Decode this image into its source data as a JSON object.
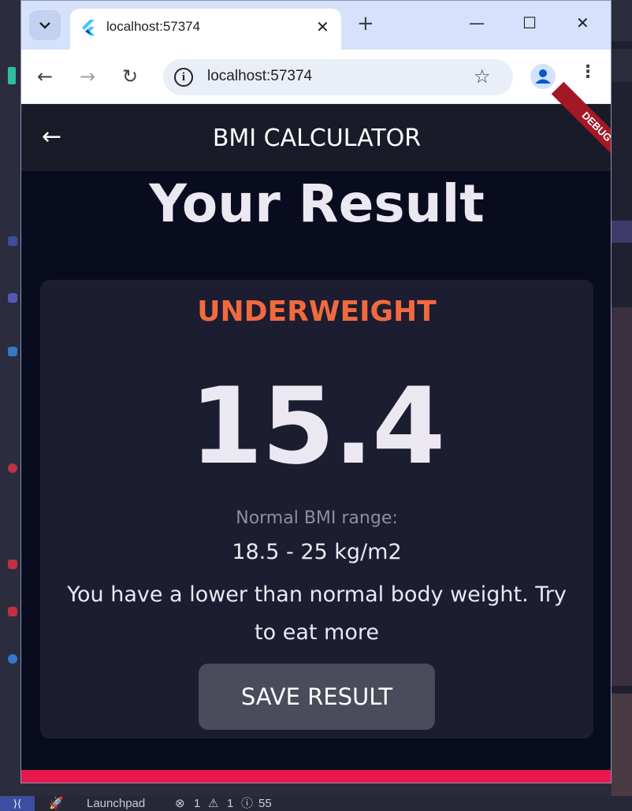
{
  "browser": {
    "tab_title": "localhost:57374",
    "tab_close": "✕",
    "new_tab": "+",
    "url": "localhost:57374",
    "controls": {
      "minimize": "—",
      "maximize": "☐",
      "close": "✕"
    }
  },
  "app": {
    "title": "BMI CALCULATOR",
    "debug_banner": "DEBUG",
    "heading": "Your Result",
    "result": {
      "category": "UNDERWEIGHT",
      "bmi": "15.4",
      "range_label": "Normal BMI range:",
      "range_value": "18.5 - 25 kg/m2",
      "advice": "You have a lower than normal body weight. Try to eat more"
    },
    "save_button": "SAVE RESULT"
  },
  "taskbar": {
    "launchpad": "Launchpad",
    "errors": "1",
    "warnings": "1",
    "info": "55"
  },
  "colors": {
    "category": "#f16a3e",
    "accent_bar": "#e8174c",
    "app_background": "#090c1f",
    "card": "#1c1d31"
  }
}
